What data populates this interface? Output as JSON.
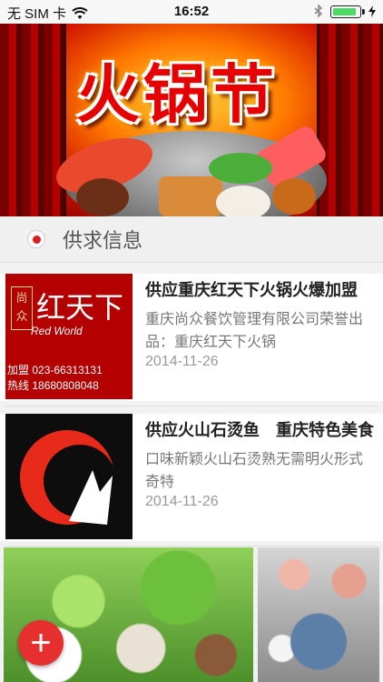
{
  "status_bar": {
    "carrier": "无 SIM 卡",
    "time": "16:52",
    "wifi_icon": "wifi-icon",
    "bluetooth_icon": "bluetooth-icon",
    "battery_level": 0.9
  },
  "banner": {
    "title": "火锅节"
  },
  "section": {
    "title": "供求信息"
  },
  "items": [
    {
      "title": "供应重庆红天下火锅火爆加盟",
      "desc": "重庆尚众餐饮管理有限公司荣誉出品：重庆红天下火锅",
      "date": "2014-11-26",
      "thumb": {
        "brand_cn": "红天下",
        "shang_zhong": "尚众",
        "brand_en": "Red World",
        "phone_label_1": "加盟",
        "phone_label_2": "热线",
        "phone_1": "023-66313131",
        "phone_2": "18680808048"
      }
    },
    {
      "title": "供应火山石烫鱼　重庆特色美食",
      "desc": "口味新颖火山石烫熟无需明火形式奇特",
      "date": "2014-11-26"
    }
  ],
  "fab": {
    "label": "+"
  },
  "colors": {
    "accent": "#e62f2f",
    "section_bg": "#f0f0f0"
  }
}
